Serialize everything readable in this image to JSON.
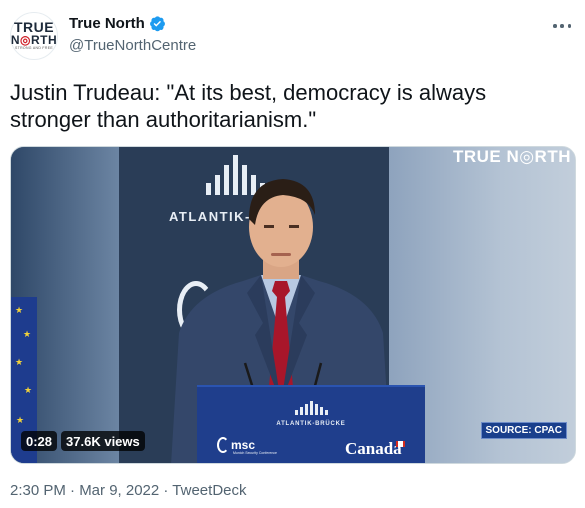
{
  "author": {
    "display_name": "True North",
    "handle": "@TrueNorthCentre",
    "verified": true,
    "avatar": {
      "line1": "TRUE",
      "line2_a": "N",
      "line2_b": "RTH",
      "line3": "STRONG AND FREE"
    }
  },
  "tweet": {
    "text": "Justin Trudeau: \"At its best, democracy is always stronger than authoritarianism.\""
  },
  "media": {
    "watermark": "TRUE N◎RTH",
    "backdrop_text": "ATLANTIK-B",
    "podium_text": "ATLANTIK-BRÜCKE",
    "podium_msc": "msc",
    "podium_msc_sub": "Munich Security Conference",
    "podium_canada": "Canada",
    "duration": "0:28",
    "views": "37.6K views",
    "source": "SOURCE: CPAC"
  },
  "meta": {
    "time": "2:30 PM",
    "date": "Mar 9, 2022",
    "client": "TweetDeck",
    "line": "2:30 PM · Mar 9, 2022 · TweetDeck"
  },
  "colors": {
    "verified_blue": "#1d9bf0",
    "secondary_text": "#536471",
    "podium_blue": "#1f3e8c"
  },
  "icons": {
    "verified": "verified-badge-icon",
    "more": "more-options-icon"
  }
}
